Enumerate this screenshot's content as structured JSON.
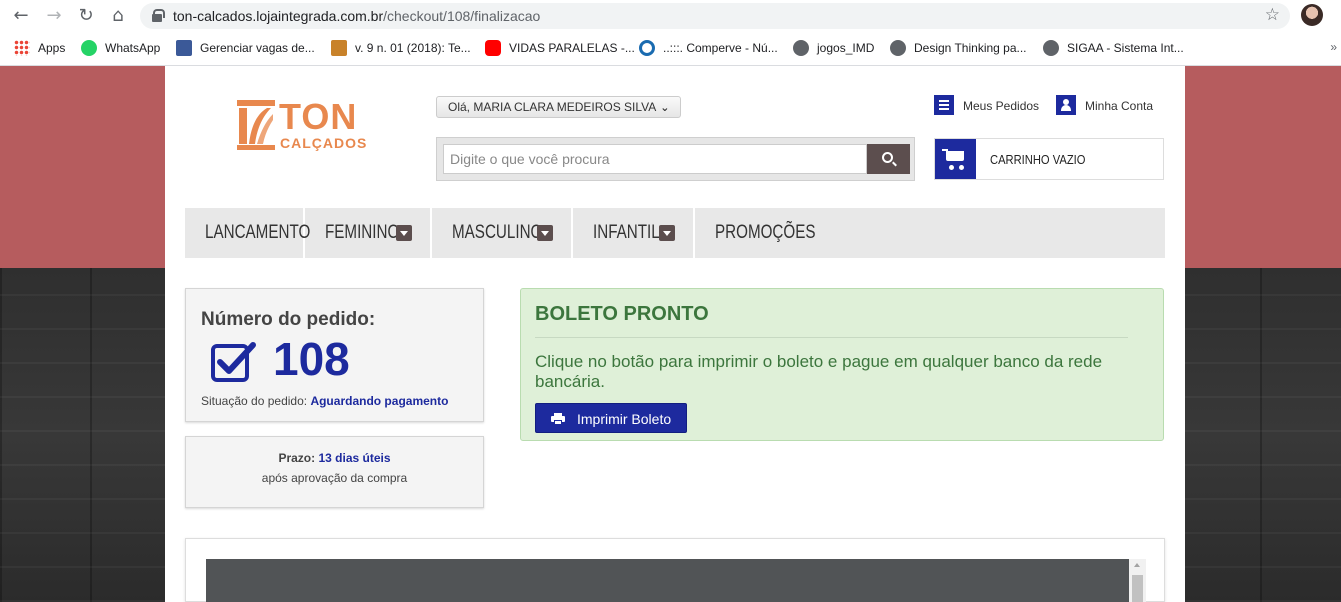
{
  "browser": {
    "url_host": "ton-calcados.lojaintegrada.com.br",
    "url_path": "/checkout/108/finalizacao",
    "bookmarks": [
      {
        "label": "Apps"
      },
      {
        "label": "WhatsApp"
      },
      {
        "label": "Gerenciar vagas de..."
      },
      {
        "label": "v. 9 n. 01 (2018): Te..."
      },
      {
        "label": "VIDAS PARALELAS -..."
      },
      {
        "label": "..:::. Comperve - Nú..."
      },
      {
        "label": "jogos_IMD"
      },
      {
        "label": "Design Thinking pa..."
      },
      {
        "label": "SIGAA - Sistema Int..."
      }
    ]
  },
  "store": {
    "logo_main": "TON",
    "logo_sub": "CALÇADOS",
    "greeting": "Olá, MARIA CLARA MEDEIROS SILVA",
    "my_orders": "Meus Pedidos",
    "my_account": "Minha Conta",
    "search_placeholder": "Digite o que você procura",
    "cart_label": "CARRINHO VAZIO",
    "menu": [
      "LANCAMENTO",
      "FEMININO",
      "MASCULINO",
      "INFANTIL",
      "PROMOÇÕES"
    ]
  },
  "order": {
    "title": "Número do pedido:",
    "number": "108",
    "status_label": "Situação do pedido:",
    "status_value": "Aguardando pagamento",
    "deadline_label": "Prazo:",
    "deadline_value": "13 dias úteis",
    "deadline_note": "após aprovação da compra"
  },
  "boleto": {
    "title": "BOLETO PRONTO",
    "text": "Clique no botão para imprimir o boleto e pague em qualquer banco da rede bancária.",
    "button": "Imprimir Boleto"
  },
  "colors": {
    "brand_blue": "#1d2a9e",
    "brand_orange": "#e8884e",
    "header_bg": "#b65c5e",
    "success_bg": "#dff0d8",
    "success_text": "#3c763d"
  }
}
